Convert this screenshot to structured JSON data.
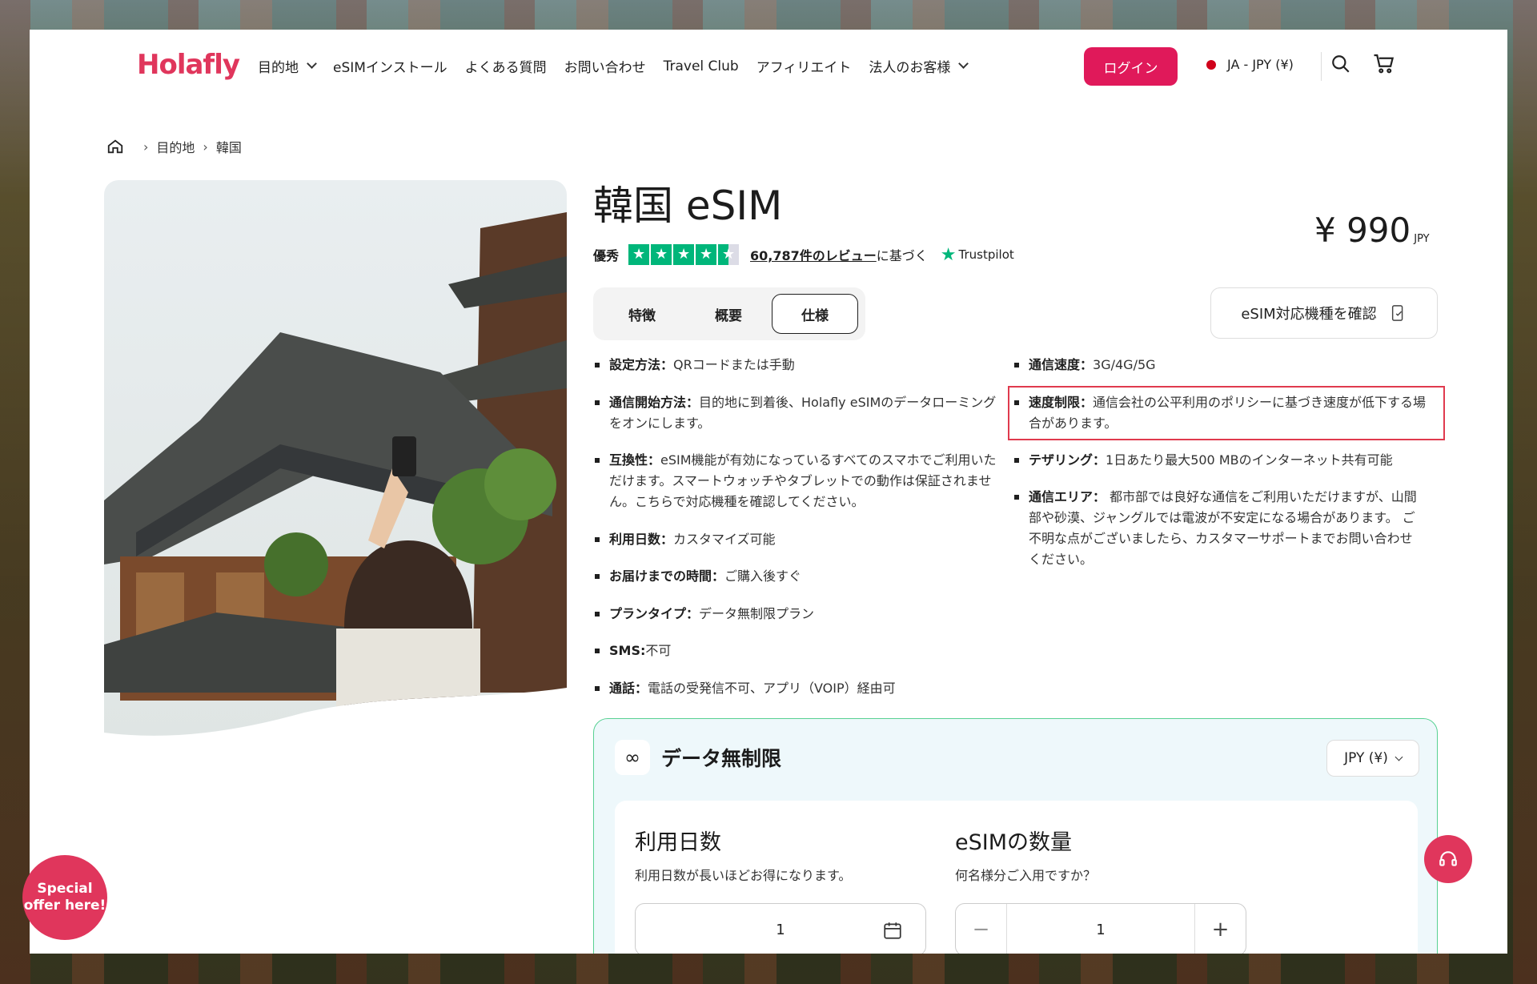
{
  "header": {
    "logo": "Holafly",
    "nav": [
      {
        "label": "目的地",
        "dropdown": true
      },
      {
        "label": "eSIMインストール",
        "dropdown": false
      },
      {
        "label": "よくある質問",
        "dropdown": false
      },
      {
        "label": "お問い合わせ",
        "dropdown": false
      },
      {
        "label": "Travel Club",
        "dropdown": false
      },
      {
        "label": "アフィリエイト",
        "dropdown": false
      },
      {
        "label": "法人のお客様",
        "dropdown": true
      }
    ],
    "login_label": "ログイン",
    "language_label": "JA - JPY (¥)"
  },
  "breadcrumb": {
    "items": [
      "目的地",
      "韓国"
    ]
  },
  "product": {
    "title": "韓国 eSIM",
    "price": "¥ 990",
    "price_currency": "JPY",
    "rating_label": "優秀",
    "rating_stars": 4.5,
    "reviews_link": "60,787件のレビュー",
    "reviews_suffix": "に基づく",
    "trustpilot": "Trustpilot",
    "tabs": [
      "特徴",
      "概要",
      "仕様"
    ],
    "active_tab": "仕様",
    "compat_button": "eSIM対応機種を確認"
  },
  "specs_left": [
    {
      "label": "設定方法：",
      "value": "QRコードまたは手動"
    },
    {
      "label": "通信開始方法：",
      "value": "目的地に到着後、Holafly eSIMのデータローミングをオンにします。"
    },
    {
      "label": "互換性：",
      "value": "eSIM機能が有効になっているすべてのスマホでご利用いただけます。スマートウォッチやタブレットでの動作は保証されません。こちらで対応機種を確認してください。"
    },
    {
      "label": "利用日数：",
      "value": "カスタマイズ可能"
    },
    {
      "label": "お届けまでの時間：",
      "value": "ご購入後すぐ"
    },
    {
      "label": "プランタイプ：",
      "value": "データ無制限プラン"
    },
    {
      "label": "SMS:",
      "value": "不可"
    },
    {
      "label": "通話：",
      "value": "電話の受発信不可、アプリ（VOIP）経由可"
    }
  ],
  "specs_right": [
    {
      "label": "通信速度：",
      "value": "3G/4G/5G"
    },
    {
      "label": "速度制限：",
      "value": "通信会社の公平利用のポリシーに基づき速度が低下する場合があります。"
    },
    {
      "label": "テザリング：",
      "value": "1日あたり最大500 MBのインターネット共有可能"
    },
    {
      "label": "通信エリア：",
      "value": " 都市部では良好な通信をご利用いただけますが、山間部や砂漠、ジャングルでは電波が不安定になる場合があります。 ご不明な点がございましたら、カスタマーサポートまでお問い合わせください。"
    }
  ],
  "plan": {
    "title": "データ無制限",
    "currency": "JPY (¥)",
    "days_title": "利用日数",
    "days_desc": "利用日数が長いほどお得になります。",
    "days_value": "1",
    "qty_title": "eSIMの数量",
    "qty_desc": "何名様分ご入用ですか？",
    "qty_value": "1",
    "minus": "−",
    "plus": "+"
  },
  "special_offer": "Special offer here!",
  "colors": {
    "brand": "#e0365c",
    "login": "#e0195a",
    "trustpilot": "#00b67a",
    "plan_border": "#58d193",
    "highlight": "#e03a4e"
  }
}
